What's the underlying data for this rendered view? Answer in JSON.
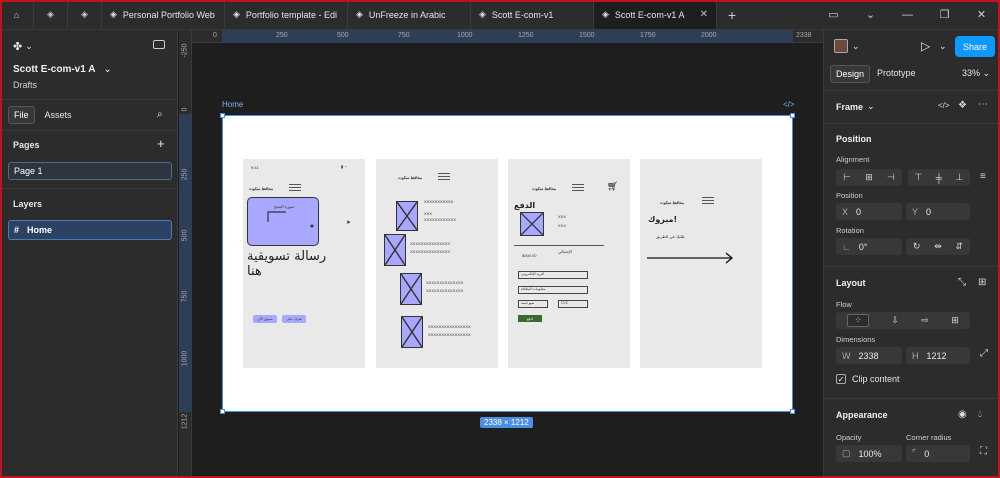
{
  "tabs": [
    {
      "label": "Personal Portfolio Web",
      "active": false
    },
    {
      "label": "Portfolio template - Edi",
      "active": false
    },
    {
      "label": "UnFreeze in Arabic",
      "active": false
    },
    {
      "label": "Scott E-com-v1",
      "active": false
    },
    {
      "label": "Scott E-com-v1 A",
      "active": true
    }
  ],
  "left": {
    "file_name": "Scott E-com-v1 A",
    "file_location": "Drafts",
    "file_tab": "File",
    "assets_tab": "Assets",
    "pages_title": "Pages",
    "pages": [
      "Page 1"
    ],
    "layers_title": "Layers",
    "layers": [
      "Home"
    ]
  },
  "canvas": {
    "ruler_top": [
      "0",
      "250",
      "500",
      "750",
      "1000",
      "1250",
      "1500",
      "1750",
      "2000",
      "2338"
    ],
    "ruler_left": [
      "-250",
      "0",
      "250",
      "500",
      "750",
      "1000",
      "1212"
    ],
    "frame_name": "Home",
    "frame_size": "2338 × 1212",
    "screens": {
      "s1": {
        "time": "9:41",
        "brand": "محافظ سكوت",
        "card_text": "صورة المنتج",
        "headline": "رسالة تسويقية هنا",
        "btn1": "تسوق الآن",
        "btn2": "تعرف على"
      },
      "s2": {
        "brand": "محافظ سكوت",
        "items": [
          "XXXXXXXXXXX",
          "XXXXXXXXXXXXXXX",
          "XXXXXXXXXXXXXX",
          "XXXXXXXXXXXXXXXX"
        ]
      },
      "s3": {
        "brand": "محافظ سكوت",
        "title": "الدفع",
        "total_label": "الإجمالي",
        "total": "$000.00",
        "email": "البريد الإلكتروني",
        "card": "معلومات البطاقة",
        "expiry": "شهر/سنة",
        "cvc": "CVC",
        "pay": "ادفع"
      },
      "s4": {
        "brand": "محافظ سكوت",
        "title": "مبروك!",
        "subtitle": "طلبك في الطريق"
      }
    }
  },
  "right": {
    "share": "Share",
    "design_tab": "Design",
    "prototype_tab": "Prototype",
    "zoom": "33%",
    "frame_title": "Frame",
    "position_title": "Position",
    "alignment_label": "Alignment",
    "position_label": "Position",
    "x_key": "X",
    "x_val": "0",
    "y_key": "Y",
    "y_val": "0",
    "rotation_label": "Rotation",
    "rotation_val": "0°",
    "layout_title": "Layout",
    "flow_label": "Flow",
    "dimensions_label": "Dimensions",
    "w_key": "W",
    "w_val": "2338",
    "h_key": "H",
    "h_val": "1212",
    "clip_content": "Clip content",
    "appearance_title": "Appearance",
    "opacity_label": "Opacity",
    "opacity_val": "100%",
    "radius_label": "Corner radius",
    "radius_val": "0"
  },
  "colors": {
    "accent": "#0d99ff",
    "selection": "#4a90e2",
    "wire_fill": "#a8a8ff",
    "pay_green": "#3a6b2e"
  }
}
